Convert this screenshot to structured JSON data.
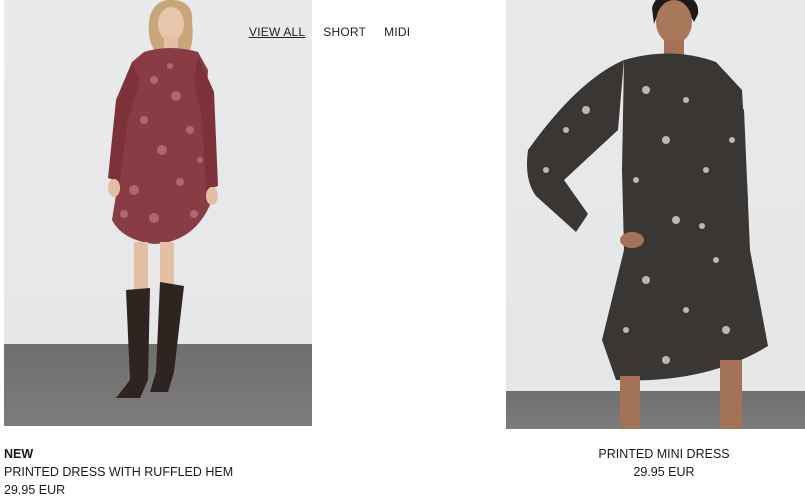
{
  "filters": {
    "items": [
      "VIEW ALL",
      "SHORT",
      "MIDI"
    ],
    "active": "VIEW ALL"
  },
  "products": [
    {
      "badge": "NEW",
      "name": "PRINTED DRESS WITH RUFFLED HEM",
      "price": "29.95 EUR",
      "image": "model-burgundy-printed-dress-boots"
    },
    {
      "badge": "",
      "name": "PRINTED MINI DRESS",
      "price": "29.95 EUR",
      "image": "model-black-white-printed-mini-dress"
    }
  ],
  "colors": {
    "dress1": "#8a3c44",
    "dress2": "#3a3633",
    "backdrop": "#e8e9eb",
    "floor": "#727273"
  }
}
